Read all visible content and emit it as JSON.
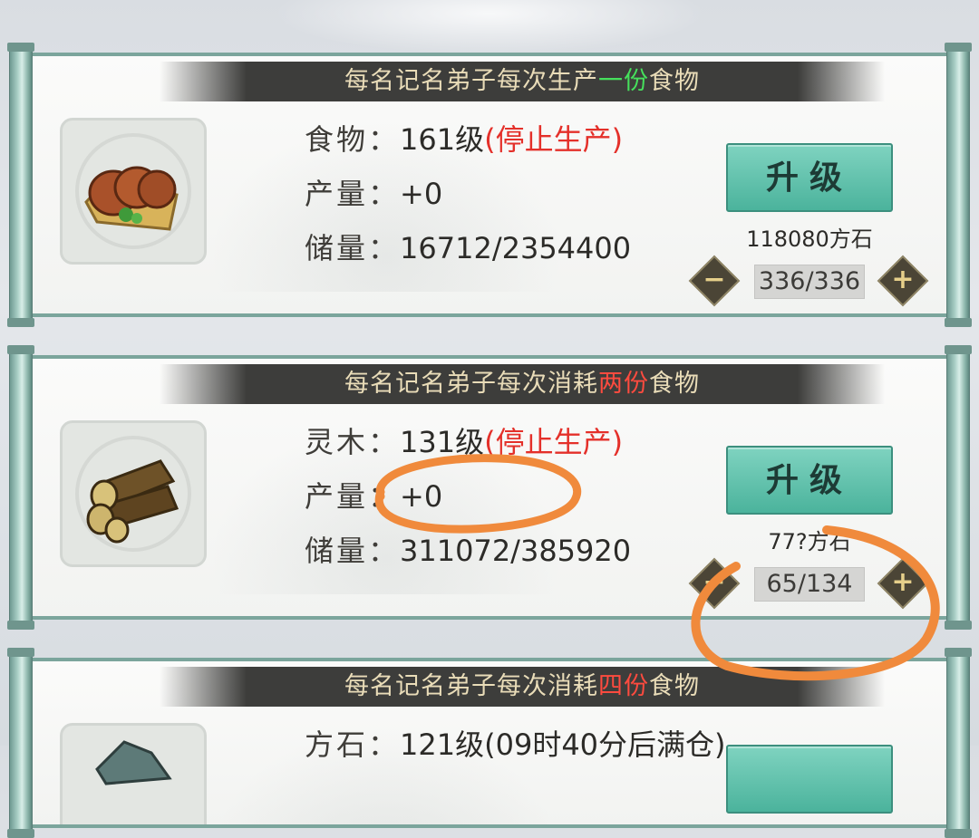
{
  "cards": [
    {
      "banner": {
        "pre": "每名记名弟子每次生产",
        "hl": "一份",
        "post": "食物"
      },
      "icon": "roast-meat-icon",
      "name_label": "食物：",
      "level": "161级",
      "status": "(停止生产)",
      "output_label": "产量：",
      "output": "+0",
      "storage_label": "储量：",
      "storage": "16712/2354400",
      "upgrade_label": "升级",
      "cost": "118080方石",
      "counter": "336/336"
    },
    {
      "banner": {
        "pre": "每名记名弟子每次消耗",
        "hl": "两份",
        "post": "食物"
      },
      "icon": "wood-logs-icon",
      "name_label": "灵木：",
      "level": "131级",
      "status": "(停止生产)",
      "output_label": "产量：",
      "output": "+0",
      "storage_label": "储量：",
      "storage": "311072/385920",
      "upgrade_label": "升级",
      "cost": "77?方石",
      "counter": "65/134"
    },
    {
      "banner": {
        "pre": "每名记名弟子每次消耗",
        "hl": "四份",
        "post": "食物"
      },
      "icon": "stone-icon",
      "name_label": "方石：",
      "level": "121级",
      "status": "(09时40分后满仓)"
    }
  ],
  "colors": {
    "highlight_green": "#46e05c",
    "highlight_red": "#ff4b3f",
    "status_red": "#e4302a",
    "annotation_orange": "#f08a3c"
  }
}
